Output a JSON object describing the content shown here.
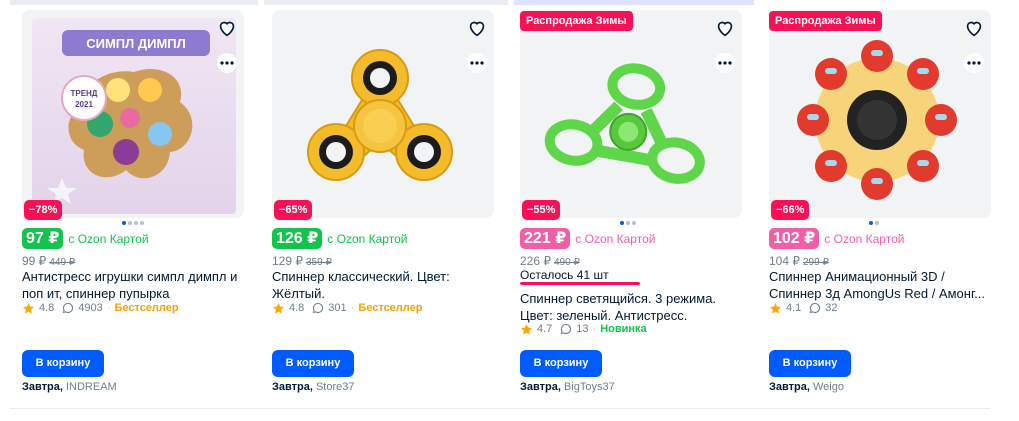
{
  "colors": {
    "accent": "#005bff",
    "promo_red": "#f91155",
    "ozon_green": "#10c44c",
    "ozon_pink": "#f45ea7",
    "bestseller": "#f8a005",
    "novelty": "#10c44c",
    "star": "#ffa800"
  },
  "products": [
    {
      "promo_badge": "",
      "discount": "−78%",
      "price": "97 ₽",
      "price_color": "#10c44c",
      "ozon_card_label": "c Ozon Картой",
      "regular_price": "99 ₽",
      "old_price": "449 ₽",
      "title": "Антистресс игрушки симпл димпл и поп ит, спиннер пупырка",
      "rating": "4.8",
      "reviews": "4903",
      "tag": "Бестселлер",
      "stock_text": "",
      "stock_fraction": null,
      "button_label": "В корзину",
      "delivery_day": "Завтра,",
      "seller": "INDREAM",
      "image_text": {
        "banner": "СИМПЛ ДИМПЛ",
        "badge_line1": "ТРЕНД",
        "badge_line2": "2021"
      },
      "dots_total": 4,
      "dots_active": 1
    },
    {
      "promo_badge": "",
      "discount": "−65%",
      "price": "126 ₽",
      "price_color": "#10c44c",
      "ozon_card_label": "c Ozon Картой",
      "regular_price": "129 ₽",
      "old_price": "359 ₽",
      "title": "Спиннер классический. Цвет: Жёлтый.",
      "rating": "4.8",
      "reviews": "301",
      "tag": "Бестселлер",
      "stock_text": "",
      "stock_fraction": null,
      "button_label": "В корзину",
      "delivery_day": "Завтра,",
      "seller": "Store37",
      "dots_total": 0,
      "dots_active": 0
    },
    {
      "promo_badge": "Распродажа Зимы",
      "discount": "−55%",
      "price": "221 ₽",
      "price_color": "#f45ea7",
      "ozon_card_label": "c Ozon Картой",
      "regular_price": "226 ₽",
      "old_price": "490 ₽",
      "title": "Спиннер светящийся. 3 режима. Цвет: зеленый. Антистресс.",
      "rating": "4.7",
      "reviews": "13",
      "tag": "Новинка",
      "stock_text": "Осталось 41 шт",
      "stock_fraction": 1.0,
      "button_label": "В корзину",
      "delivery_day": "Завтра,",
      "seller": "BigToys37",
      "dots_total": 3,
      "dots_active": 1
    },
    {
      "promo_badge": "Распродажа Зимы",
      "discount": "−66%",
      "price": "102 ₽",
      "price_color": "#f45ea7",
      "ozon_card_label": "c Ozon Картой",
      "regular_price": "104 ₽",
      "old_price": "299 ₽",
      "title": "Спиннер Анимационный 3D / Спиннер 3д AmongUs Red / Амонг...",
      "rating": "4.1",
      "reviews": "32",
      "tag": "",
      "stock_text": "",
      "stock_fraction": null,
      "button_label": "В корзину",
      "delivery_day": "Завтра,",
      "seller": "Weigo",
      "dots_total": 2,
      "dots_active": 1
    }
  ]
}
